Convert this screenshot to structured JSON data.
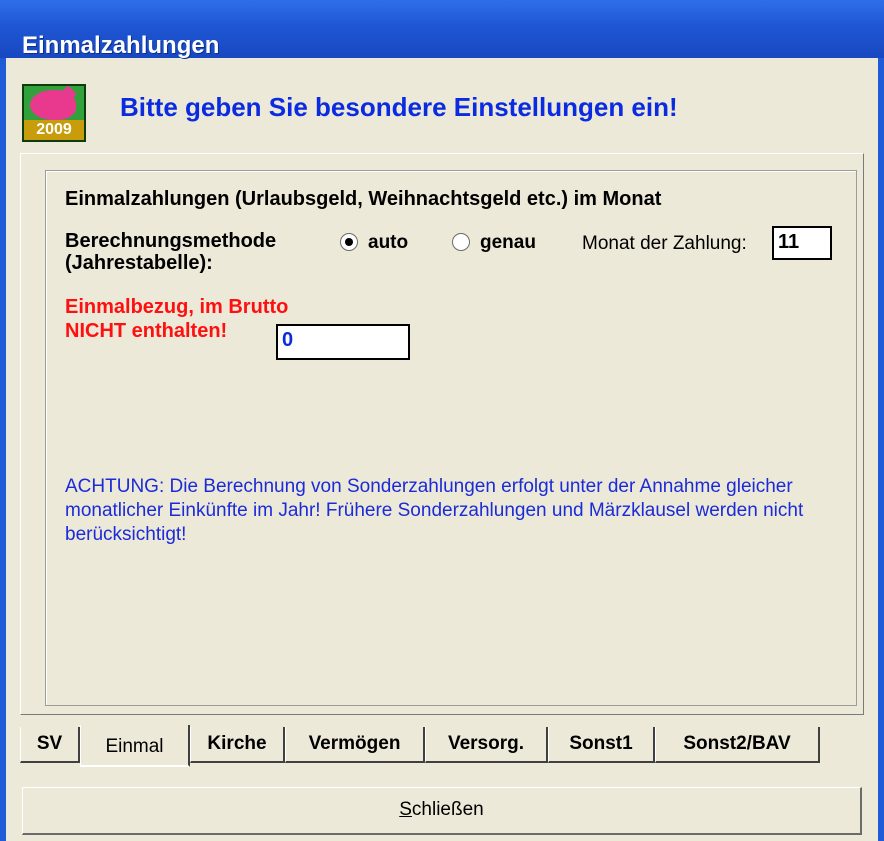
{
  "window": {
    "title": "Einmalzahlungen"
  },
  "header": {
    "icon_name": "piggy-bank-2009-icon",
    "icon_year": "2009",
    "headline": "Bitte geben Sie besondere Einstellungen ein!"
  },
  "form": {
    "section_title": "Einmalzahlungen (Urlaubsgeld, Weihnachtsgeld etc.) im Monat",
    "method_label_line1": "Berechnungsmethode",
    "method_label_line2": "(Jahrestabelle):",
    "radio_auto_label": "auto",
    "radio_auto_checked": true,
    "radio_genau_label": "genau",
    "radio_genau_checked": false,
    "month_label": "Monat der Zahlung:",
    "month_value": "11",
    "one_time_label_line1": "Einmalbezug, im Brutto",
    "one_time_label_line2": "NICHT enthalten!",
    "one_time_value": "0",
    "note": "ACHTUNG: Die Berechnung von Sonderzahlungen erfolgt unter der Annahme gleicher monatlicher Einkünfte im Jahr! Frühere Sonderzahlungen und Märzklausel werden nicht berücksichtigt!"
  },
  "tabs": [
    {
      "label": "SV",
      "active": false
    },
    {
      "label": "Einmal",
      "active": true
    },
    {
      "label": "Kirche",
      "active": false
    },
    {
      "label": "Vermögen",
      "active": false
    },
    {
      "label": "Versorg.",
      "active": false
    },
    {
      "label": "Sonst1",
      "active": false
    },
    {
      "label": "Sonst2/BAV",
      "active": false
    }
  ],
  "footer": {
    "close_label_underlined": "S",
    "close_label_rest": "chließen"
  },
  "colors": {
    "titlebar": "#1f56d4",
    "headline": "#0b2be0",
    "warning_red": "#ff1010",
    "note_blue": "#1b2bd8",
    "dialog_bg": "#ece9d8"
  }
}
